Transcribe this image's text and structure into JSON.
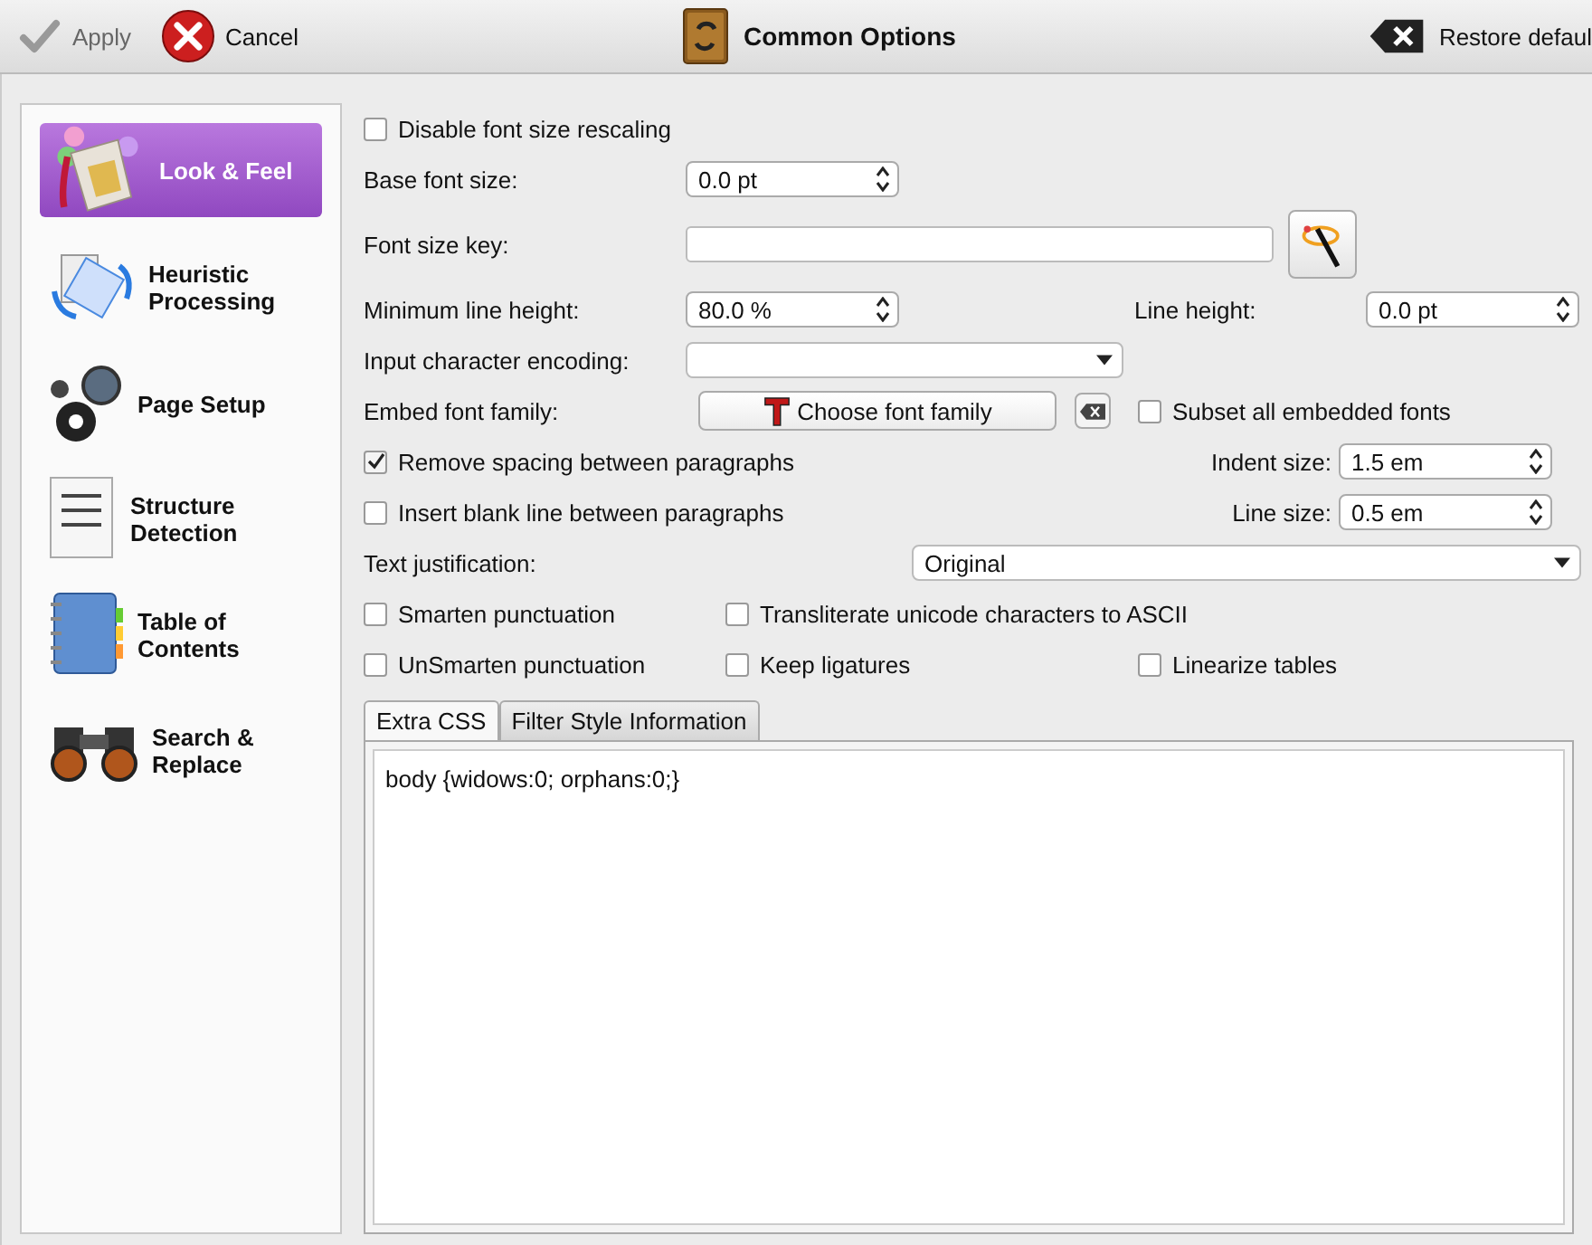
{
  "toolbar": {
    "apply": {
      "label": "Apply",
      "disabled": true
    },
    "cancel": {
      "label": "Cancel"
    },
    "title": "Common Options",
    "restore": {
      "label": "Restore defaul"
    }
  },
  "sidebar": {
    "items": [
      {
        "label": "Look & Feel",
        "selected": true,
        "kind": "paint"
      },
      {
        "label": "Heuristic Processing",
        "selected": false,
        "kind": "heuristic"
      },
      {
        "label": "Page Setup",
        "selected": false,
        "kind": "gears"
      },
      {
        "label": "Structure Detection",
        "selected": false,
        "kind": "document"
      },
      {
        "label": "Table of Contents",
        "selected": false,
        "kind": "notebook"
      },
      {
        "label": "Search & Replace",
        "selected": false,
        "kind": "binoculars"
      }
    ]
  },
  "options": {
    "disable_rescaling": {
      "label": "Disable font size rescaling",
      "checked": false
    },
    "base_font_size": {
      "label": "Base font size:",
      "value": "0.0 pt"
    },
    "font_size_key": {
      "label": "Font size key:"
    },
    "min_line_height": {
      "label": "Minimum line height:",
      "value": "80.0 %"
    },
    "line_height": {
      "label": "Line height:",
      "value": "0.0 pt"
    },
    "encoding": {
      "label": "Input character encoding:"
    },
    "embed_font": {
      "label": "Embed font family:",
      "button": "Choose font family"
    },
    "subset_fonts": {
      "label": "Subset all embedded fonts",
      "checked": false
    },
    "remove_spacing": {
      "label": "Remove spacing between paragraphs",
      "checked": true
    },
    "indent_size": {
      "label": "Indent size:",
      "value": "1.5 em"
    },
    "insert_blank": {
      "label": "Insert blank line between paragraphs",
      "checked": false
    },
    "line_size": {
      "label": "Line size:",
      "value": "0.5 em"
    },
    "justification": {
      "label": "Text justification:",
      "value": "Original"
    },
    "smarten": {
      "label": "Smarten punctuation",
      "checked": false
    },
    "transliterate": {
      "label": "Transliterate unicode characters to ASCII",
      "checked": false
    },
    "unsmarten": {
      "label": "UnSmarten punctuation",
      "checked": false
    },
    "keep_ligatures": {
      "label": "Keep ligatures",
      "checked": false
    },
    "linearize": {
      "label": "Linearize tables",
      "checked": false
    }
  },
  "css_tabs": [
    {
      "label": "Extra CSS",
      "selected": true
    },
    {
      "label": "Filter Style Information",
      "selected": false
    }
  ],
  "css_text": "body {widows:0; orphans:0;}"
}
